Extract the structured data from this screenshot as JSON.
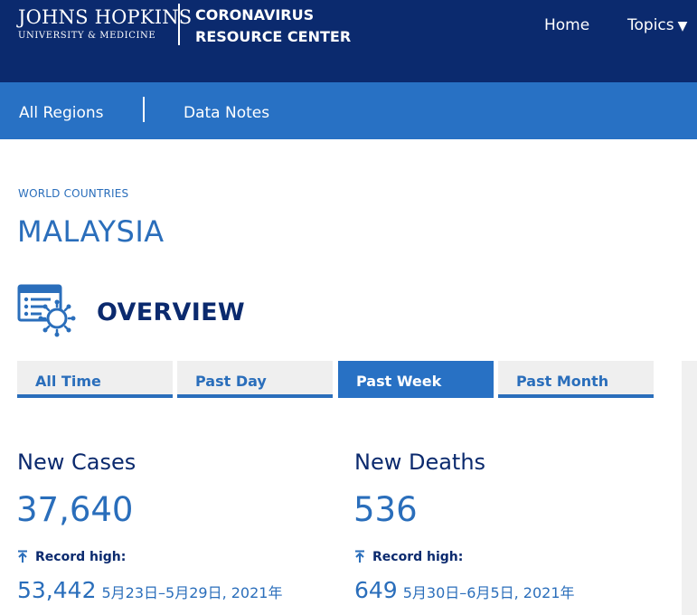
{
  "header": {
    "logo_main": "JOHNS HOPKINS",
    "logo_sub": "UNIVERSITY & MEDICINE",
    "center_line1": "CORONAVIRUS",
    "center_line2": "RESOURCE CENTER",
    "nav": {
      "home": "Home",
      "topics": "Topics",
      "caret": "▼"
    },
    "colors": {
      "header_bg": "#0b2a6e",
      "subnav_bg": "#2871c4",
      "accent": "#2a6ebb"
    }
  },
  "subnav": {
    "all_regions": "All Regions",
    "data_notes": "Data Notes"
  },
  "breadcrumb": "WORLD COUNTRIES",
  "country": "MALAYSIA",
  "overview": {
    "title": "OVERVIEW",
    "icon": "data-overview-virus-icon",
    "tabs": [
      "All Time",
      "Past Day",
      "Past Week",
      "Past Month"
    ],
    "active_tab": "Past Week"
  },
  "metrics": {
    "cases": {
      "label": "New Cases",
      "value": "37,640",
      "record_label": "Record high:",
      "record_value": "53,442",
      "record_range": "5月23日–5月29日, 2021年"
    },
    "deaths": {
      "label": "New Deaths",
      "value": "536",
      "record_label": "Record high:",
      "record_value": "649",
      "record_range": "5月30日–6月5日, 2021年"
    }
  }
}
